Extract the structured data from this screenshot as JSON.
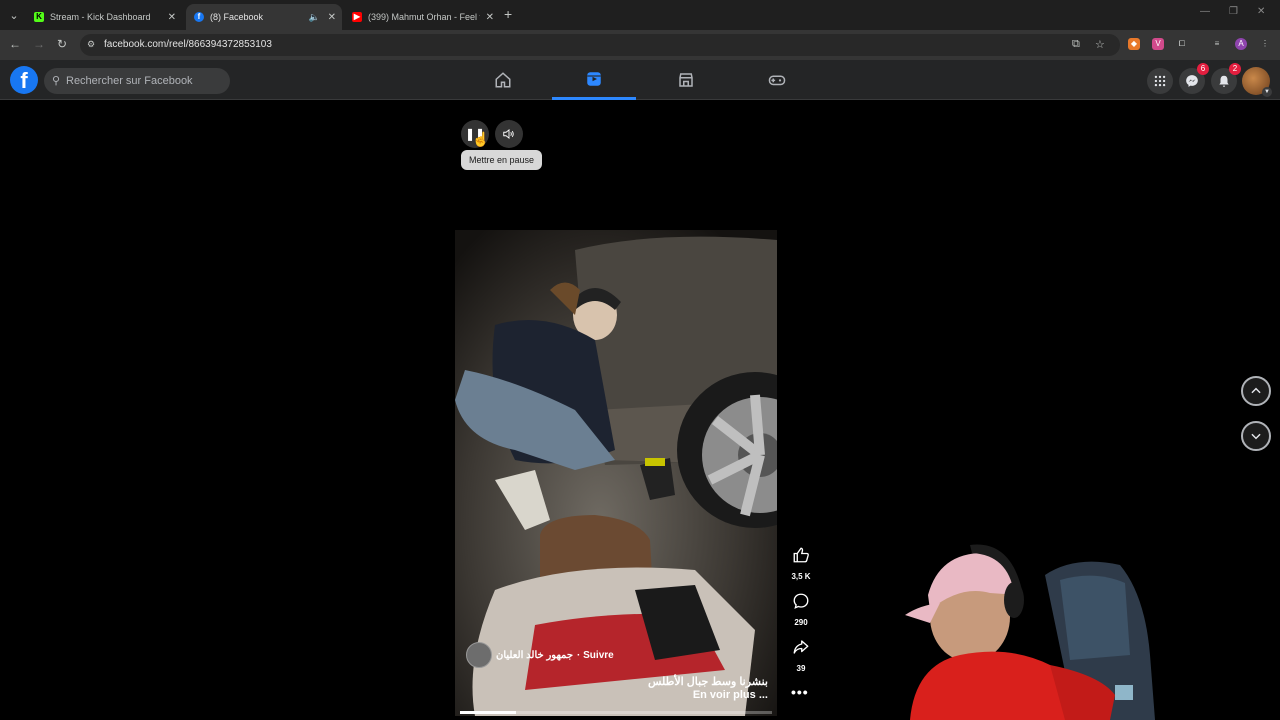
{
  "browser": {
    "tabs": [
      {
        "title": "Stream - Kick Dashboard",
        "favicon": "kick-icon",
        "color": "#53fc18"
      },
      {
        "title": "(8) Facebook",
        "favicon": "facebook-icon",
        "color": "#1877f2"
      },
      {
        "title": "(399) Mahmut Orhan - Feel fea",
        "favicon": "youtube-icon",
        "color": "#ff0000"
      }
    ],
    "url": "facebook.com/reel/866394372853103"
  },
  "facebook": {
    "search_placeholder": "Rechercher sur Facebook",
    "nav": [
      "home-icon",
      "reels-icon",
      "marketplace-icon",
      "gaming-icon"
    ],
    "messenger_badge": "6",
    "notifications_badge": "2",
    "accent": "#2d88ff"
  },
  "reel": {
    "tooltip": "Mettre en pause",
    "author": "جمهور خالد العليان",
    "follow": "· Suivre",
    "caption": "بنشرنا وسط جبال الأطلس",
    "see_more": "En voir plus ...",
    "likes": "3,5 K",
    "comments": "290",
    "shares": "39",
    "progress": 0.18
  }
}
